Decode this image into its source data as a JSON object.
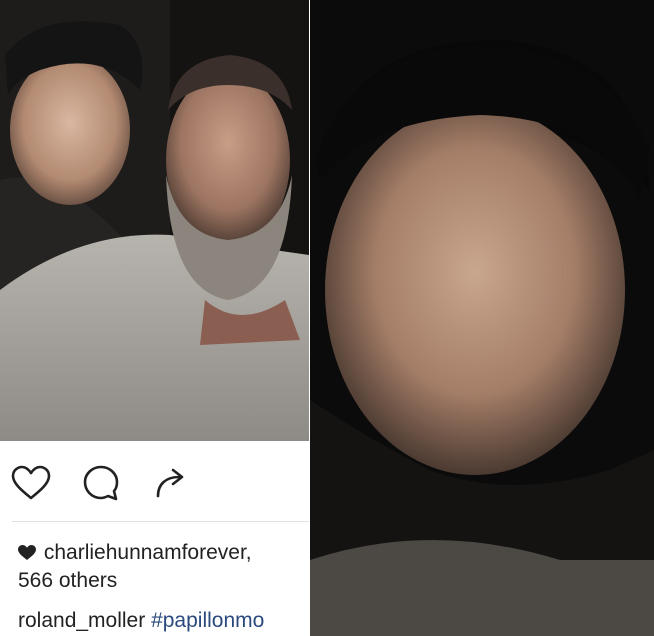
{
  "post": {
    "likes_user": "charliehunnamforever,",
    "likes_others": "566 others",
    "caption_user": "roland_moller",
    "caption_hashtag": "#papillonmo"
  },
  "icons": {
    "like": "heart-outline-icon",
    "comment": "comment-bubble-icon",
    "share": "share-arrow-icon",
    "liked": "heart-filled-icon"
  },
  "colors": {
    "text": "#222222",
    "hashtag": "#2a4a7e",
    "divider": "#e2e2e2"
  }
}
